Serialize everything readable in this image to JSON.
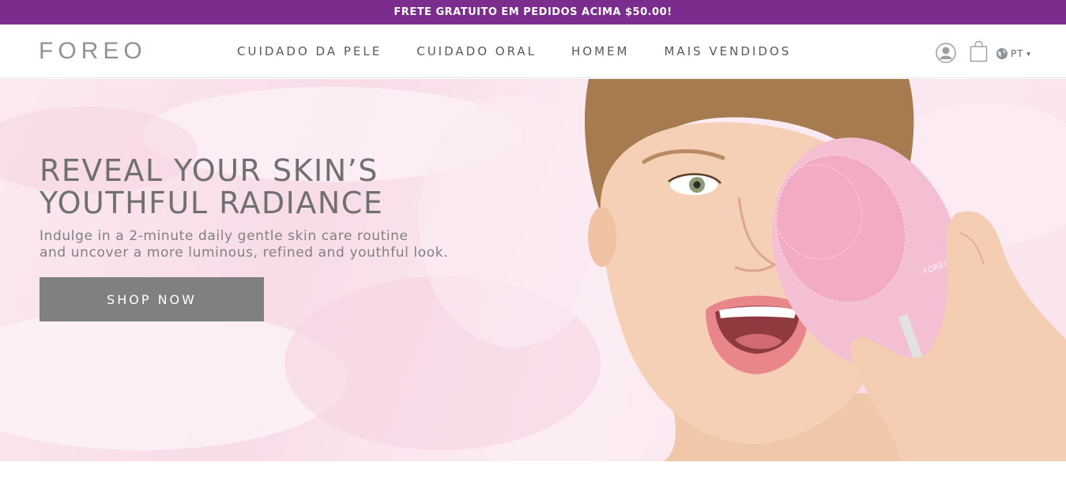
{
  "promo_banner": {
    "text": "FRETE GRATUITO EM PEDIDOS ACIMA $50.00!"
  },
  "header": {
    "logo": "FOREO",
    "nav": [
      {
        "label": "CUIDADO DA PELE"
      },
      {
        "label": "CUIDADO ORAL"
      },
      {
        "label": "HOMEM"
      },
      {
        "label": "MAIS VENDIDOS"
      }
    ],
    "icons": {
      "account": "user-icon",
      "cart": "shopping-bag-icon",
      "language": "globe-icon"
    },
    "language": {
      "label": "PT"
    }
  },
  "hero": {
    "headline_line1": "REVEAL YOUR SKIN’S",
    "headline_line2": "YOUTHFUL RADIANCE",
    "subtext_line1": "Indulge in a 2-minute daily gentle skin care routine",
    "subtext_line2": "and uncover a more luminous, refined and youthful look.",
    "cta_label": "SHOP NOW",
    "device_brand": "FOREO"
  },
  "colors": {
    "promo_bg": "#7b2d8e",
    "button_bg": "#808080",
    "hero_bg": "#f8dce8",
    "device_pink": "#f2b8cc"
  }
}
